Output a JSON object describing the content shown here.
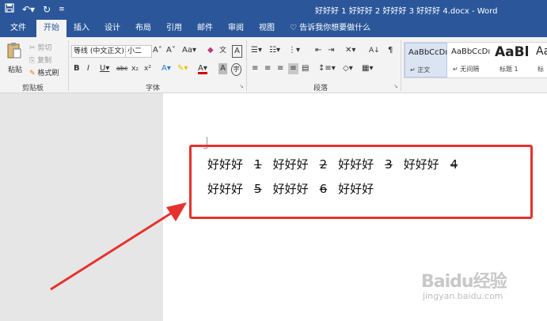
{
  "titlebar": {
    "document_title": "好好好 1 好好好 2 好好好 3 好好好 4.docx - Word"
  },
  "tabs": [
    "文件",
    "开始",
    "插入",
    "设计",
    "布局",
    "引用",
    "邮件",
    "审阅",
    "视图"
  ],
  "active_tab": "开始",
  "tellme": "告诉我你想要做什么",
  "clipboard": {
    "paste": "粘贴",
    "cut": "剪切",
    "copy": "复制",
    "format_painter": "格式刷",
    "label": "剪贴板"
  },
  "font": {
    "name": "等线 (中文正文)",
    "size": "小二",
    "label": "字体",
    "aa_label": "Aa"
  },
  "paragraph": {
    "label": "段落"
  },
  "styles": [
    {
      "sample": "AaBbCcDı",
      "name": "正文"
    },
    {
      "sample": "AaBbCcDı",
      "name": "无间隔"
    },
    {
      "sample": "AaBl",
      "name": "标题 1"
    },
    {
      "sample": "Aa",
      "name": "标"
    }
  ],
  "document": {
    "line1": [
      {
        "text": "好好好",
        "strike": false
      },
      {
        "text": "1",
        "strike": true
      },
      {
        "text": "好好好",
        "strike": false
      },
      {
        "text": "2",
        "strike": true
      },
      {
        "text": "好好好",
        "strike": false
      },
      {
        "text": "3",
        "strike": true
      },
      {
        "text": "好好好",
        "strike": false
      },
      {
        "text": "4",
        "strike": true
      }
    ],
    "line2": [
      {
        "text": "好好好",
        "strike": false
      },
      {
        "text": "5",
        "strike": true
      },
      {
        "text": "好好好",
        "strike": false
      },
      {
        "text": "6",
        "strike": true
      },
      {
        "text": "好好好",
        "strike": false
      }
    ]
  },
  "watermark": {
    "logo": "Baidu经验",
    "url": "jingyan.baidu.com"
  },
  "colors": {
    "word_blue": "#2b579a",
    "highlight_red": "#e5322e"
  }
}
